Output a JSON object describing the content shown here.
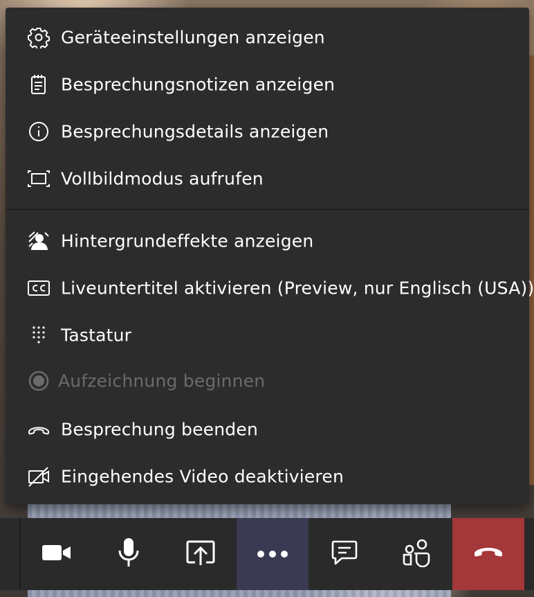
{
  "menu": {
    "items": [
      {
        "label": "Geräteeinstellungen anzeigen",
        "icon": "gear-icon"
      },
      {
        "label": "Besprechungsnotizen anzeigen",
        "icon": "notes-icon"
      },
      {
        "label": "Besprechungsdetails anzeigen",
        "icon": "info-icon"
      },
      {
        "label": "Vollbildmodus aufrufen",
        "icon": "fullscreen-icon"
      },
      {
        "label": "Hintergrundeffekte anzeigen",
        "icon": "background-effects-icon"
      },
      {
        "label": "Liveuntertitel aktivieren (Preview, nur Englisch (USA))",
        "icon": "closed-captions-icon"
      },
      {
        "label": "Tastatur",
        "icon": "keypad-icon"
      },
      {
        "label": "Aufzeichnung beginnen",
        "icon": "record-icon",
        "disabled": true
      },
      {
        "label": "Besprechung beenden",
        "icon": "end-meeting-icon"
      },
      {
        "label": "Eingehendes Video deaktivieren",
        "icon": "video-off-icon"
      }
    ]
  },
  "toolbar": {
    "buttons": [
      {
        "name": "camera",
        "icon": "camera-icon"
      },
      {
        "name": "microphone",
        "icon": "microphone-icon"
      },
      {
        "name": "share",
        "icon": "share-screen-icon"
      },
      {
        "name": "more",
        "icon": "more-options-icon",
        "active": true
      },
      {
        "name": "chat",
        "icon": "chat-icon"
      },
      {
        "name": "participants",
        "icon": "participants-icon"
      },
      {
        "name": "hangup",
        "icon": "hangup-icon"
      }
    ]
  },
  "colors": {
    "menu_bg": "#2d2c2c",
    "text": "#ffffff",
    "disabled_text": "#6b6b6b",
    "toolbar_bg": "#2a2a2a",
    "active_button_bg": "#3a3a52",
    "hangup_bg": "#a4373a"
  }
}
